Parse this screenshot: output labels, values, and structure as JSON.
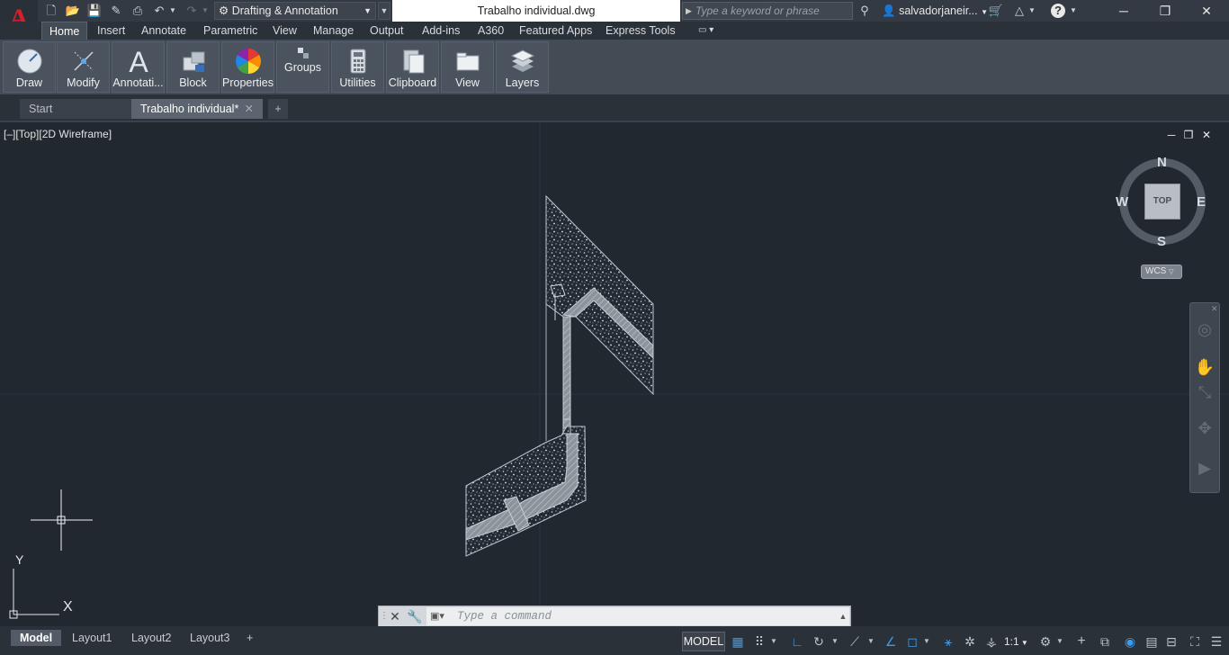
{
  "app": {
    "window_title": "Trabalho individual.dwg",
    "workspace": "Drafting & Annotation",
    "search_placeholder": "Type a keyword or phrase",
    "user": "salvadorjaneir..."
  },
  "ribbon": {
    "tabs": [
      "Home",
      "Insert",
      "Annotate",
      "Parametric",
      "View",
      "Manage",
      "Output",
      "Add-ins",
      "A360",
      "Featured Apps",
      "Express Tools"
    ],
    "active_tab": "Home",
    "panels": [
      {
        "label": "Draw",
        "icon": "circle-pencil-icon"
      },
      {
        "label": "Modify",
        "icon": "move-arrows-icon"
      },
      {
        "label": "Annotati...",
        "icon": "text-a-icon"
      },
      {
        "label": "Block",
        "icon": "block-insert-icon"
      },
      {
        "label": "Properties",
        "icon": "color-wheel-icon"
      },
      {
        "label": "Groups",
        "icon": "group-icon"
      },
      {
        "label": "Utilities",
        "icon": "calculator-icon"
      },
      {
        "label": "Clipboard",
        "icon": "clipboard-icon"
      },
      {
        "label": "View",
        "icon": "view-icon"
      },
      {
        "label": "Layers",
        "icon": "layers-icon"
      }
    ]
  },
  "doc_tabs": {
    "start": "Start",
    "current": "Trabalho individual*"
  },
  "viewport": {
    "controls": "[–][Top][2D Wireframe]",
    "viewcube": {
      "top": "TOP",
      "n": "N",
      "s": "S",
      "e": "E",
      "w": "W",
      "ucs": "WCS"
    },
    "ucs_x": "X",
    "ucs_y": "Y"
  },
  "command": {
    "placeholder": "Type a command"
  },
  "layouts": {
    "tabs": [
      "Model",
      "Layout1",
      "Layout2",
      "Layout3"
    ],
    "active": "Model"
  },
  "status": {
    "model": "MODEL",
    "scale": "1:1"
  },
  "colors": {
    "accent_red": "#d4202a",
    "viewport_bg": "#212830",
    "status_blue": "#3d9be9"
  }
}
